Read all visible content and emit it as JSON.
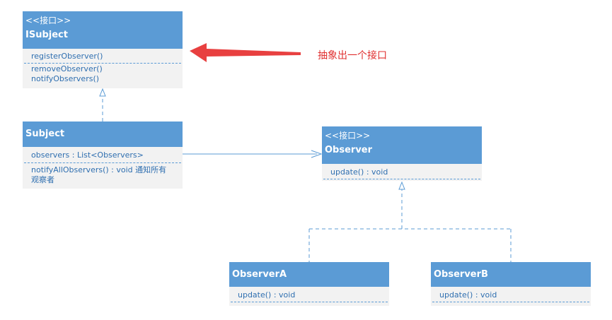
{
  "colors": {
    "box_header": "#5b9bd5",
    "box_body": "#f2f2f2",
    "member_text": "#2f6fb0",
    "arrow": "#e84040",
    "note": "#e03030"
  },
  "isubject": {
    "stereotype": "<<接口>>",
    "name": "ISubject",
    "methods": [
      "registerObserver()",
      "removeObserver()",
      "notifyObservers()"
    ]
  },
  "subject": {
    "name": "Subject",
    "field": "observers : List<Observers>",
    "method": "notifyAllObservers() : void 通知所有观察者"
  },
  "observer": {
    "stereotype": "<<接口>>",
    "name": "Observer",
    "method": "update() : void"
  },
  "observer_a": {
    "name": "ObserverA",
    "method": "update() : void"
  },
  "observer_b": {
    "name": "ObserverB",
    "method": "update() : void"
  },
  "annotation": "抽象出一个接口"
}
